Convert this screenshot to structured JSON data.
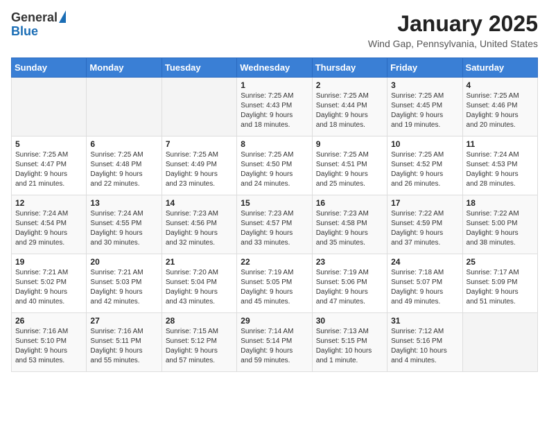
{
  "header": {
    "logo_general": "General",
    "logo_blue": "Blue",
    "month_title": "January 2025",
    "location": "Wind Gap, Pennsylvania, United States"
  },
  "calendar": {
    "days_of_week": [
      "Sunday",
      "Monday",
      "Tuesday",
      "Wednesday",
      "Thursday",
      "Friday",
      "Saturday"
    ],
    "weeks": [
      [
        {
          "day": "",
          "info": ""
        },
        {
          "day": "",
          "info": ""
        },
        {
          "day": "",
          "info": ""
        },
        {
          "day": "1",
          "info": "Sunrise: 7:25 AM\nSunset: 4:43 PM\nDaylight: 9 hours\nand 18 minutes."
        },
        {
          "day": "2",
          "info": "Sunrise: 7:25 AM\nSunset: 4:44 PM\nDaylight: 9 hours\nand 18 minutes."
        },
        {
          "day": "3",
          "info": "Sunrise: 7:25 AM\nSunset: 4:45 PM\nDaylight: 9 hours\nand 19 minutes."
        },
        {
          "day": "4",
          "info": "Sunrise: 7:25 AM\nSunset: 4:46 PM\nDaylight: 9 hours\nand 20 minutes."
        }
      ],
      [
        {
          "day": "5",
          "info": "Sunrise: 7:25 AM\nSunset: 4:47 PM\nDaylight: 9 hours\nand 21 minutes."
        },
        {
          "day": "6",
          "info": "Sunrise: 7:25 AM\nSunset: 4:48 PM\nDaylight: 9 hours\nand 22 minutes."
        },
        {
          "day": "7",
          "info": "Sunrise: 7:25 AM\nSunset: 4:49 PM\nDaylight: 9 hours\nand 23 minutes."
        },
        {
          "day": "8",
          "info": "Sunrise: 7:25 AM\nSunset: 4:50 PM\nDaylight: 9 hours\nand 24 minutes."
        },
        {
          "day": "9",
          "info": "Sunrise: 7:25 AM\nSunset: 4:51 PM\nDaylight: 9 hours\nand 25 minutes."
        },
        {
          "day": "10",
          "info": "Sunrise: 7:25 AM\nSunset: 4:52 PM\nDaylight: 9 hours\nand 26 minutes."
        },
        {
          "day": "11",
          "info": "Sunrise: 7:24 AM\nSunset: 4:53 PM\nDaylight: 9 hours\nand 28 minutes."
        }
      ],
      [
        {
          "day": "12",
          "info": "Sunrise: 7:24 AM\nSunset: 4:54 PM\nDaylight: 9 hours\nand 29 minutes."
        },
        {
          "day": "13",
          "info": "Sunrise: 7:24 AM\nSunset: 4:55 PM\nDaylight: 9 hours\nand 30 minutes."
        },
        {
          "day": "14",
          "info": "Sunrise: 7:23 AM\nSunset: 4:56 PM\nDaylight: 9 hours\nand 32 minutes."
        },
        {
          "day": "15",
          "info": "Sunrise: 7:23 AM\nSunset: 4:57 PM\nDaylight: 9 hours\nand 33 minutes."
        },
        {
          "day": "16",
          "info": "Sunrise: 7:23 AM\nSunset: 4:58 PM\nDaylight: 9 hours\nand 35 minutes."
        },
        {
          "day": "17",
          "info": "Sunrise: 7:22 AM\nSunset: 4:59 PM\nDaylight: 9 hours\nand 37 minutes."
        },
        {
          "day": "18",
          "info": "Sunrise: 7:22 AM\nSunset: 5:00 PM\nDaylight: 9 hours\nand 38 minutes."
        }
      ],
      [
        {
          "day": "19",
          "info": "Sunrise: 7:21 AM\nSunset: 5:02 PM\nDaylight: 9 hours\nand 40 minutes."
        },
        {
          "day": "20",
          "info": "Sunrise: 7:21 AM\nSunset: 5:03 PM\nDaylight: 9 hours\nand 42 minutes."
        },
        {
          "day": "21",
          "info": "Sunrise: 7:20 AM\nSunset: 5:04 PM\nDaylight: 9 hours\nand 43 minutes."
        },
        {
          "day": "22",
          "info": "Sunrise: 7:19 AM\nSunset: 5:05 PM\nDaylight: 9 hours\nand 45 minutes."
        },
        {
          "day": "23",
          "info": "Sunrise: 7:19 AM\nSunset: 5:06 PM\nDaylight: 9 hours\nand 47 minutes."
        },
        {
          "day": "24",
          "info": "Sunrise: 7:18 AM\nSunset: 5:07 PM\nDaylight: 9 hours\nand 49 minutes."
        },
        {
          "day": "25",
          "info": "Sunrise: 7:17 AM\nSunset: 5:09 PM\nDaylight: 9 hours\nand 51 minutes."
        }
      ],
      [
        {
          "day": "26",
          "info": "Sunrise: 7:16 AM\nSunset: 5:10 PM\nDaylight: 9 hours\nand 53 minutes."
        },
        {
          "day": "27",
          "info": "Sunrise: 7:16 AM\nSunset: 5:11 PM\nDaylight: 9 hours\nand 55 minutes."
        },
        {
          "day": "28",
          "info": "Sunrise: 7:15 AM\nSunset: 5:12 PM\nDaylight: 9 hours\nand 57 minutes."
        },
        {
          "day": "29",
          "info": "Sunrise: 7:14 AM\nSunset: 5:14 PM\nDaylight: 9 hours\nand 59 minutes."
        },
        {
          "day": "30",
          "info": "Sunrise: 7:13 AM\nSunset: 5:15 PM\nDaylight: 10 hours\nand 1 minute."
        },
        {
          "day": "31",
          "info": "Sunrise: 7:12 AM\nSunset: 5:16 PM\nDaylight: 10 hours\nand 4 minutes."
        },
        {
          "day": "",
          "info": ""
        }
      ]
    ]
  }
}
